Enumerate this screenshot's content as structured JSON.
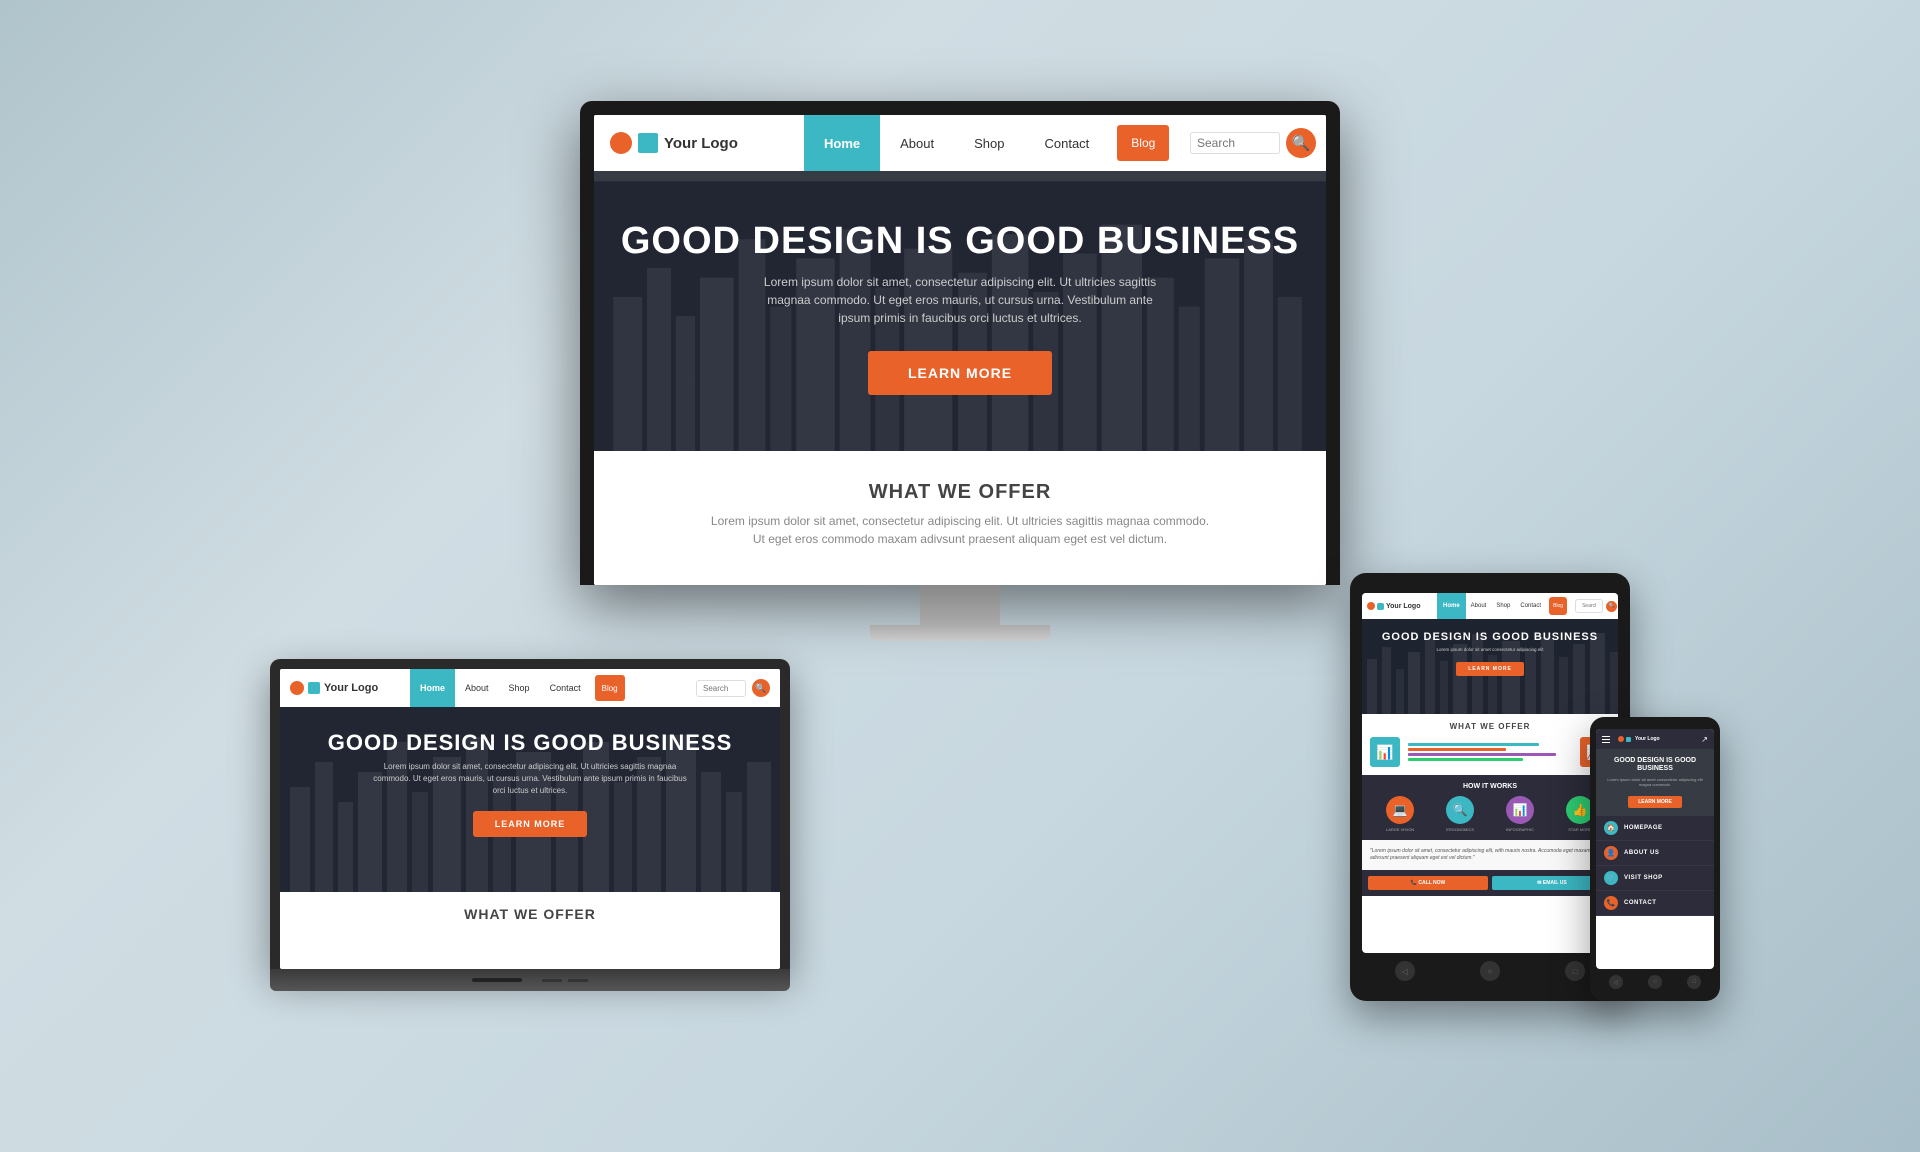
{
  "page": {
    "background": "linear-gradient(135deg, #b0c4cc 0%, #d0dde3 30%, #c8d8e0 60%, #a8bec8 100%)"
  },
  "website": {
    "logo_text": "Your Logo",
    "nav_items": [
      "Home",
      "About",
      "Shop",
      "Contact",
      "Blog",
      "Search"
    ],
    "hero_title": "GOOD DESIGN IS GOOD BUSINESS",
    "hero_subtitle": "Lorem ipsum dolor sit amet, consectetur adipiscing elit. Ut ultricies sagittis magnaa commodo. Ut eget eros mauris, ut cursus urna. Vestibulum ante ipsum primis in faucibus orci luctus et ultrices.",
    "hero_btn": "LEARN MORE",
    "offer_title": "WHAT WE OFFER",
    "offer_text": "Lorem ipsum dolor sit amet, consectetur adipiscing elit. Ut ultricies sagittis magnaa commodo. Ut eget eros commodo maxam adivsunt praesent aliquam eget est vel dictum.",
    "search_placeholder": "Search"
  },
  "phone_menu": {
    "items": [
      {
        "label": "HOMEPAGE",
        "color": "#3bb8c4",
        "icon": "🏠"
      },
      {
        "label": "ABOUT US",
        "color": "#e8622a",
        "icon": "👤"
      },
      {
        "label": "VISIT SHOP",
        "color": "#3bb8c4",
        "icon": "🛒"
      },
      {
        "label": "CONTACT",
        "color": "#e8622a",
        "icon": "📞"
      }
    ]
  },
  "how_it_works": {
    "title": "HOW IT WORKS",
    "items": [
      {
        "icon": "💻",
        "label": "LARGE VISION",
        "color": "#e8622a"
      },
      {
        "icon": "🔍",
        "label": "ERGONOMICS",
        "color": "#3bb8c4"
      },
      {
        "icon": "📊",
        "label": "INFOGRAPHIC",
        "color": "#9b59b6"
      },
      {
        "icon": "👍",
        "label": "STAR MORE",
        "color": "#2ecc71"
      }
    ]
  }
}
